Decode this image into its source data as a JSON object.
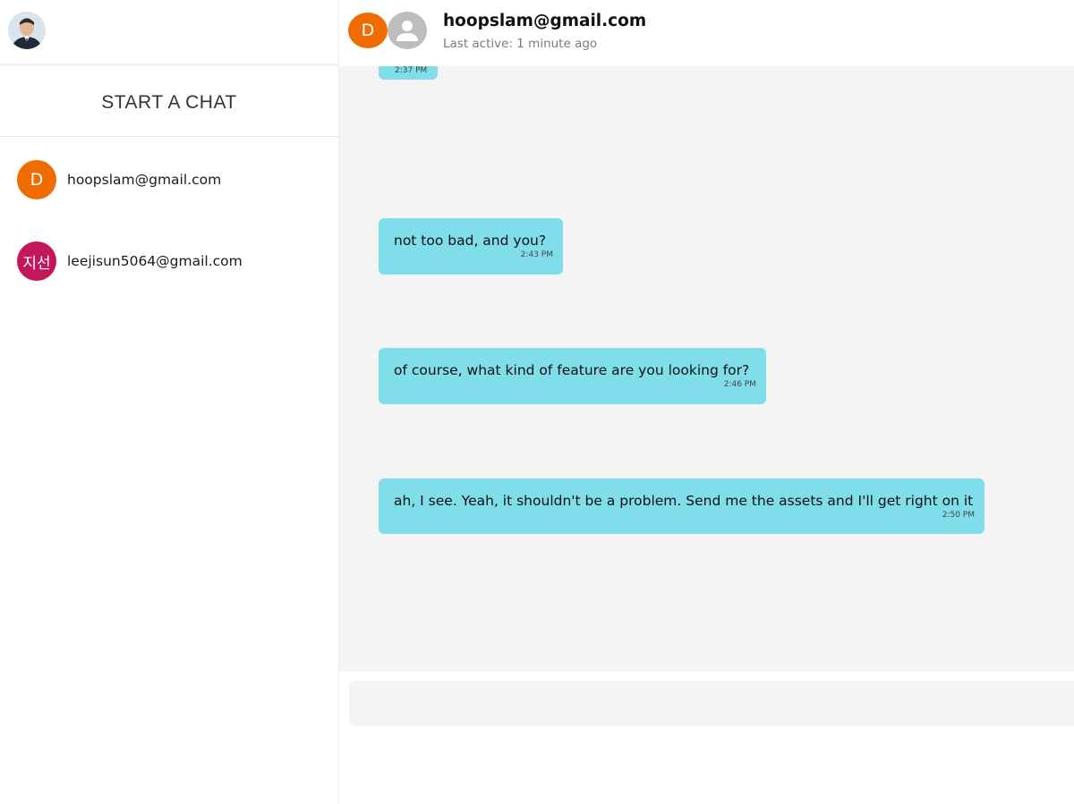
{
  "colors": {
    "bubble": "#80deea",
    "chat_bg": "#f4f4f4",
    "avatar_d": "#ef6c00",
    "avatar_jisun": "#c2185b",
    "avatar_generic": "#bdbdbd"
  },
  "sidebar": {
    "user_avatar_icon": "user-photo-avatar",
    "start_chat_label": "START A CHAT",
    "contacts": [
      {
        "initials": "D",
        "label": "hoopslam@gmail.com"
      },
      {
        "initials": "지선",
        "label": "leejisun5064@gmail.com"
      }
    ]
  },
  "chat": {
    "header": {
      "initials": "D",
      "generic_avatar_icon": "person-icon",
      "title": "hoopslam@gmail.com",
      "status": "Last active: 1 minute ago"
    },
    "messages": [
      {
        "text": "not too bad, and you?",
        "time": "2:43 PM"
      },
      {
        "text": "of course, what kind of feature are you looking for?",
        "time": "2:46 PM"
      },
      {
        "text": "ah, I see. Yeah, it shouldn't be a problem. Send me the assets and I'll get right on it",
        "time": "2:50 PM"
      }
    ],
    "composer": {
      "placeholder": ""
    }
  }
}
